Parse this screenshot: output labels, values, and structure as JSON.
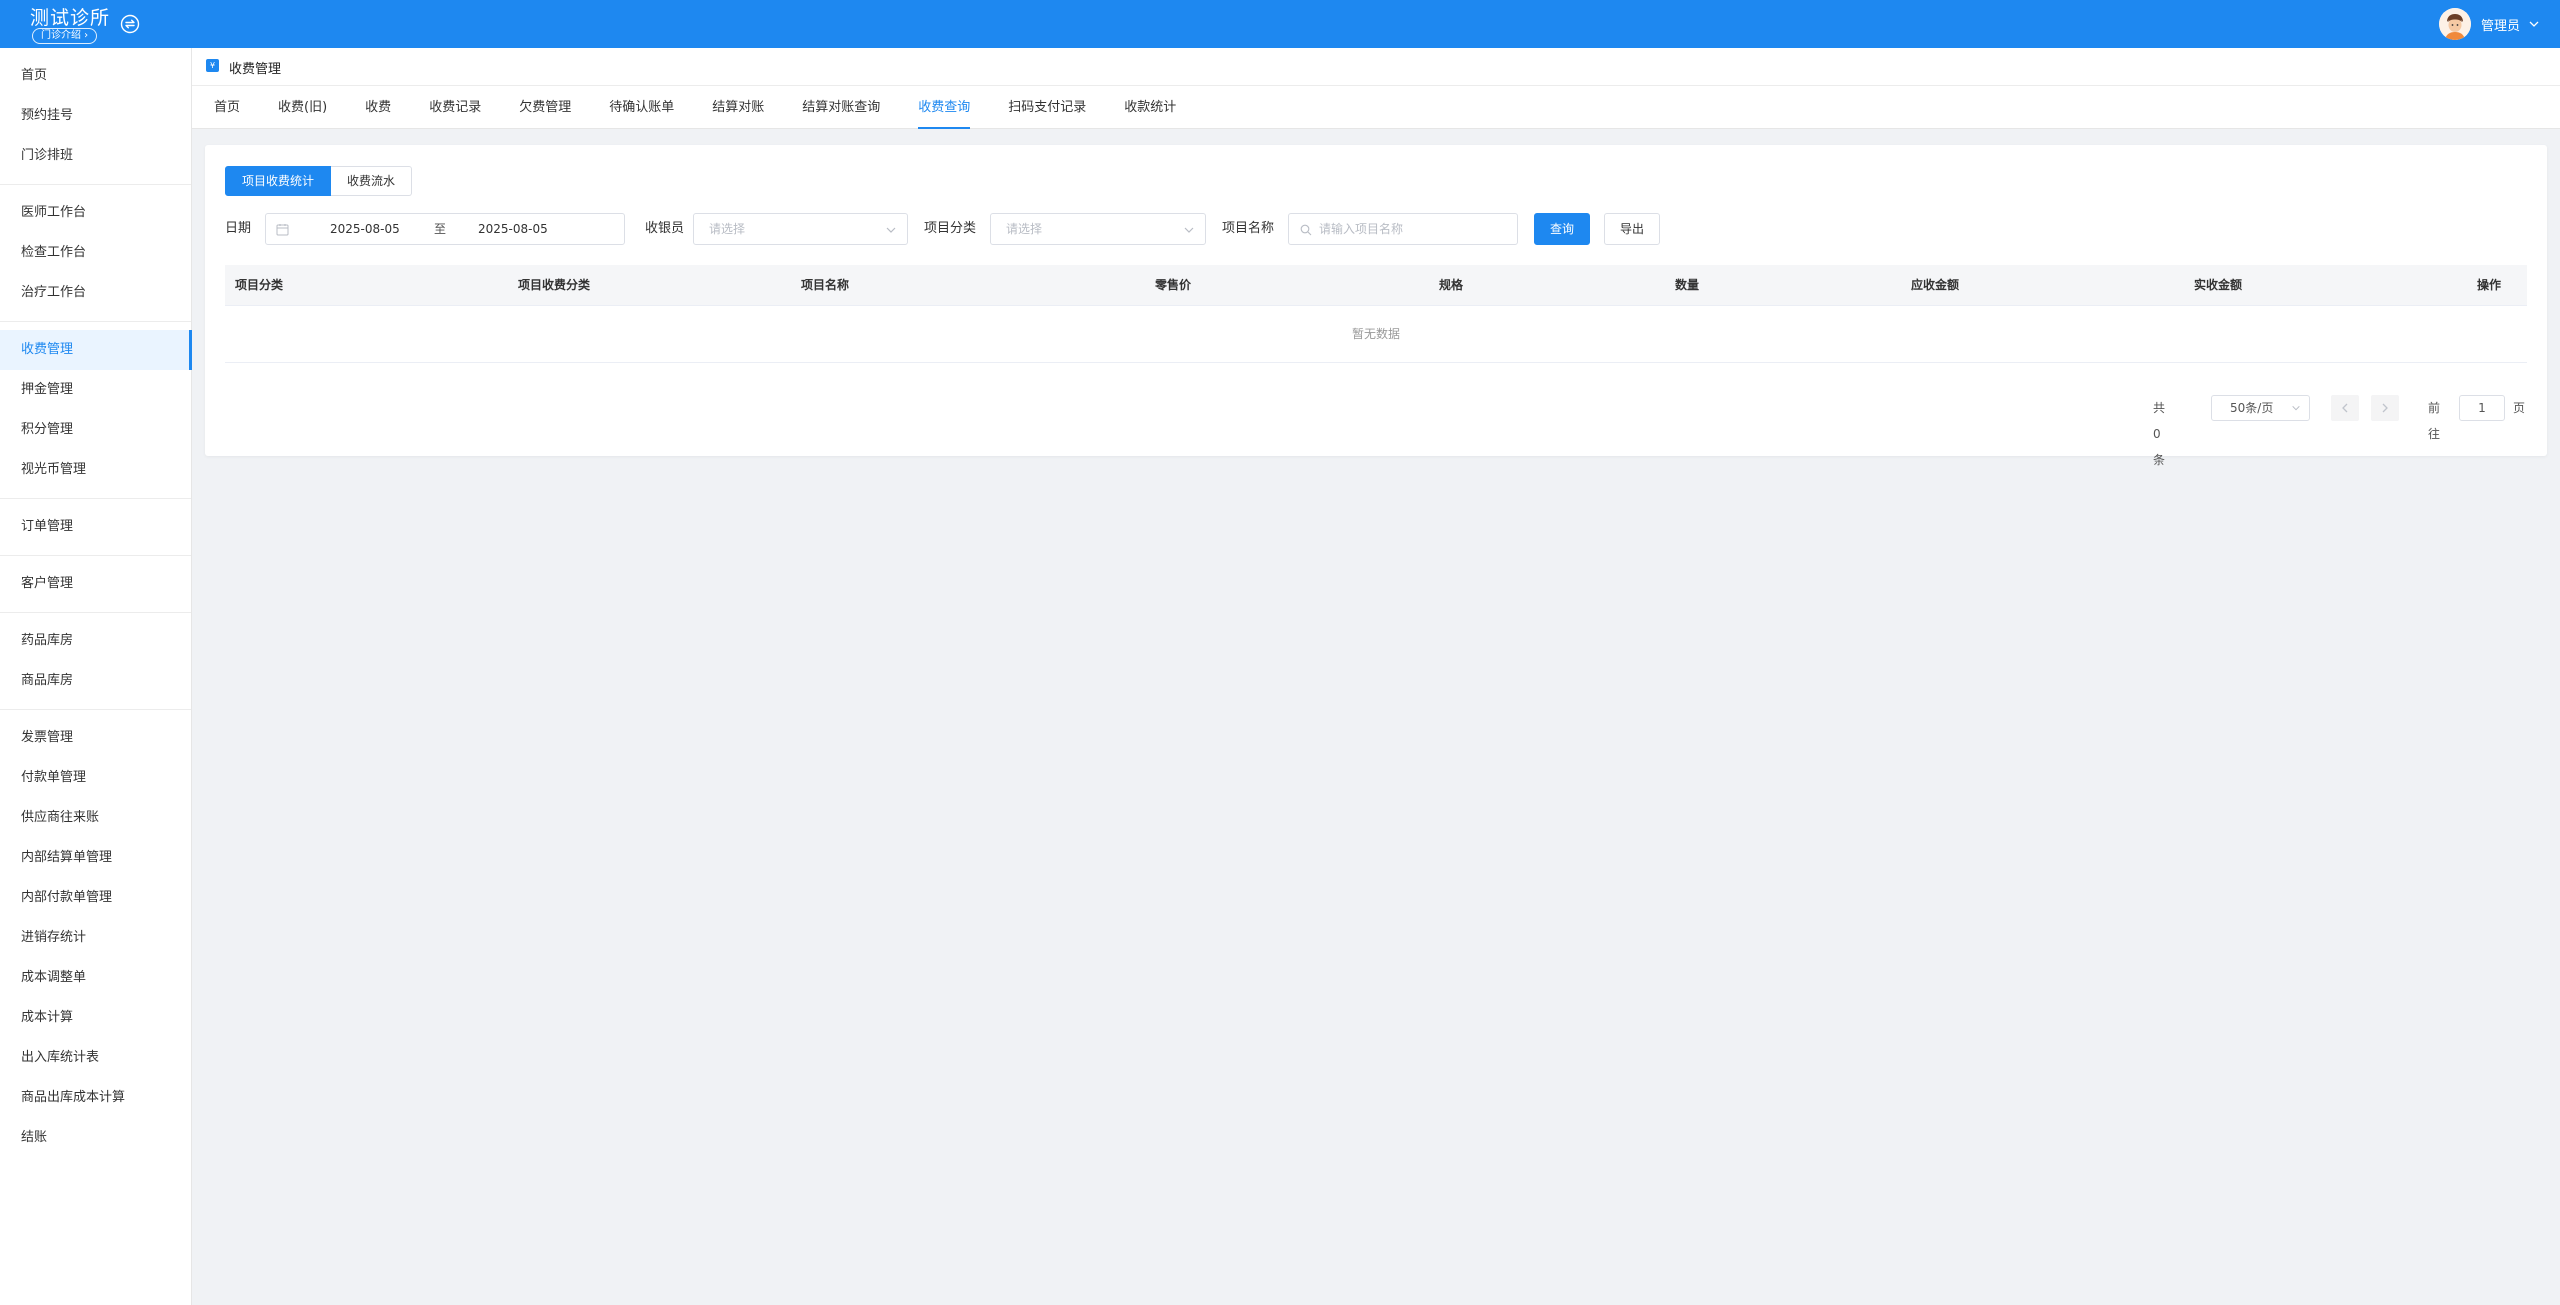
{
  "header": {
    "brand_title": "测试诊所",
    "brand_tag": "门诊介绍 ›",
    "user_name": "管理员"
  },
  "sidebar": {
    "groups": [
      [
        "首页",
        "预约挂号",
        "门诊排班"
      ],
      [
        "医师工作台",
        "检查工作台",
        "治疗工作台"
      ],
      [
        "收费管理",
        "押金管理",
        "积分管理",
        "视光币管理"
      ],
      [
        "订单管理"
      ],
      [
        "客户管理"
      ],
      [
        "药品库房",
        "商品库房"
      ],
      [
        "发票管理",
        "付款单管理",
        "供应商往来账",
        "内部结算单管理",
        "内部付款单管理",
        "进销存统计",
        "成本调整单",
        "成本计算",
        "出入库统计表",
        "商品出库成本计算",
        "结账"
      ]
    ],
    "active": "收费管理"
  },
  "page": {
    "icon_text": "¥",
    "title": "收费管理"
  },
  "tabs": [
    "首页",
    "收费(旧)",
    "收费",
    "收费记录",
    "欠费管理",
    "待确认账单",
    "结算对账",
    "结算对账查询",
    "收费查询",
    "扫码支付记录",
    "收款统计"
  ],
  "active_tab": "收费查询",
  "segment": {
    "on": "项目收费统计",
    "off": "收费流水"
  },
  "filters": {
    "date_label": "日期",
    "date_start": "2025-08-05",
    "date_sep": "至",
    "date_end": "2025-08-05",
    "cashier_label": "收银员",
    "cashier_placeholder": "请选择",
    "category_label": "项目分类",
    "category_placeholder": "请选择",
    "name_label": "项目名称",
    "name_placeholder": "请输入项目名称",
    "query_button": "查询",
    "export_button": "导出"
  },
  "table": {
    "columns": [
      "项目分类",
      "项目收费分类",
      "项目名称",
      "零售价",
      "规格",
      "数量",
      "应收金额",
      "实收金额",
      "操作"
    ],
    "empty_text": "暂无数据"
  },
  "pagination": {
    "total": "共 0 条",
    "page_size": "50条/页",
    "goto_label": "前往",
    "page": "1",
    "unit": "页"
  },
  "colors": {
    "primary": "#1e88f0"
  }
}
